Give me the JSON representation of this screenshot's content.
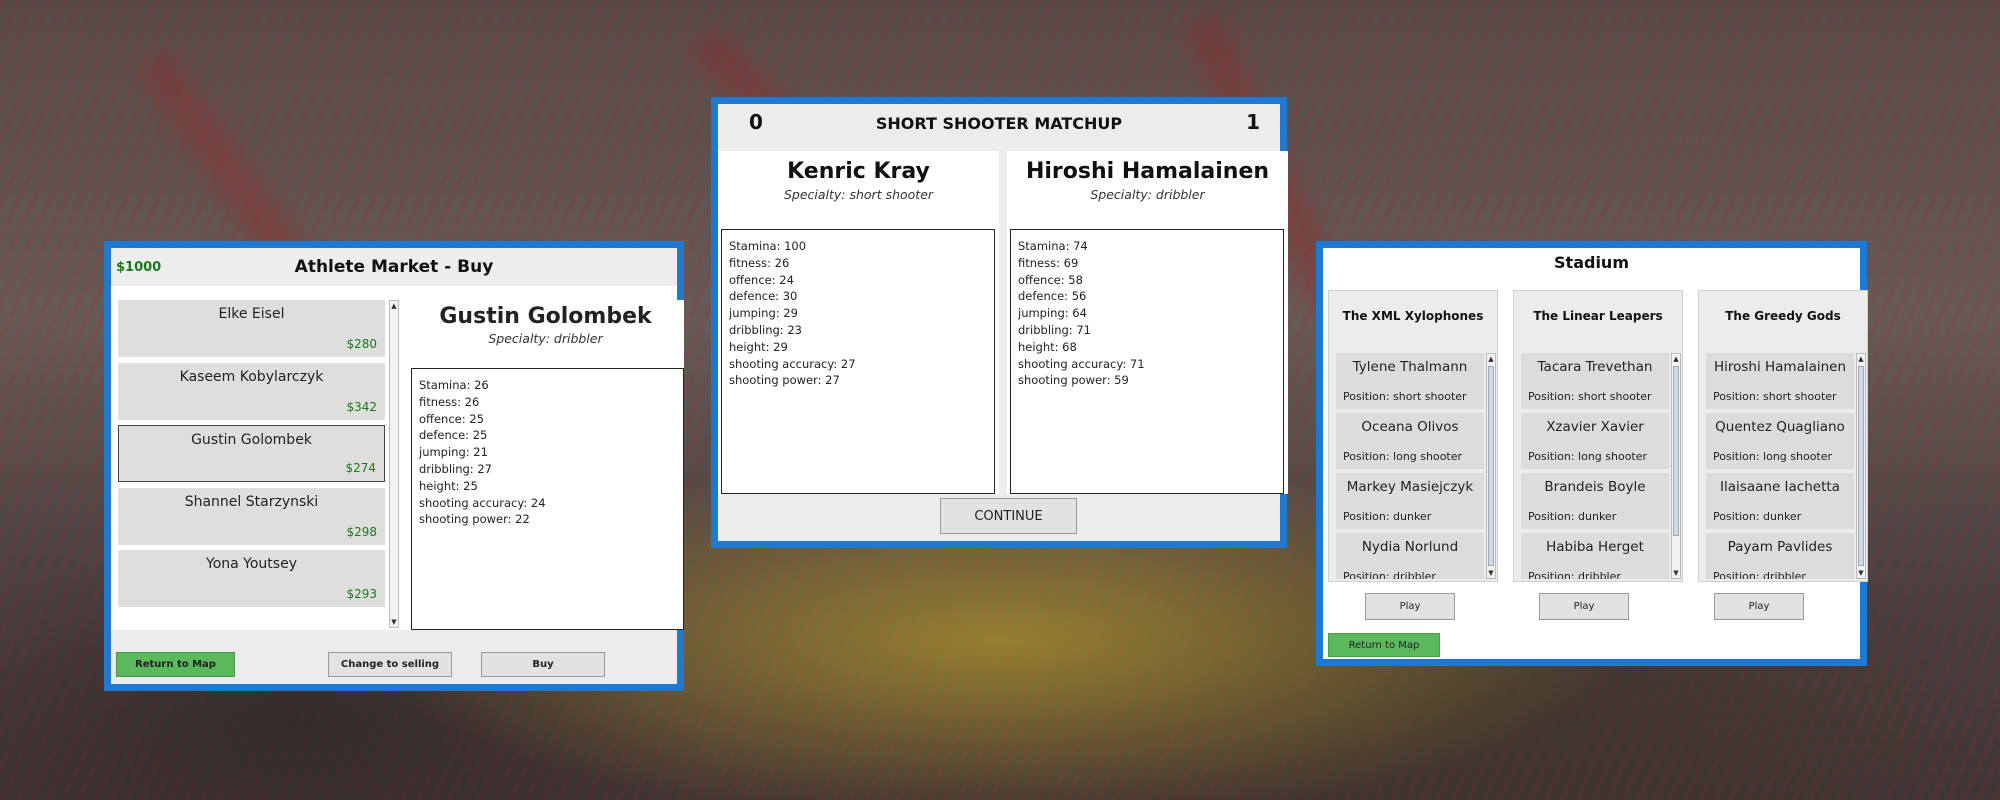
{
  "market": {
    "money": "$1000",
    "title": "Athlete Market - Buy",
    "athletes": [
      {
        "name": "Elke Eisel",
        "price": "$280"
      },
      {
        "name": "Kaseem Kobylarczyk",
        "price": "$342"
      },
      {
        "name": "Gustin Golombek",
        "price": "$274"
      },
      {
        "name": "Shannel Starzynski",
        "price": "$298"
      },
      {
        "name": "Yona Youtsey",
        "price": "$293"
      }
    ],
    "selected": {
      "name": "Gustin Golombek",
      "specialty": "Specialty: dribbler",
      "stats": [
        "Stamina: 26",
        "fitness: 26",
        "offence: 25",
        "defence: 25",
        "jumping: 21",
        "dribbling: 27",
        "height: 25",
        "shooting accuracy: 24",
        "shooting power: 22"
      ]
    },
    "buttons": {
      "return": "Return to Map",
      "change": "Change to selling",
      "buy": "Buy"
    }
  },
  "matchup": {
    "score_left": "0",
    "score_right": "1",
    "title": "SHORT SHOOTER MATCHUP",
    "left": {
      "name": "Kenric Kray",
      "specialty": "Specialty: short shooter",
      "stats": [
        "Stamina: 100",
        "fitness: 26",
        "offence: 24",
        "defence: 30",
        "jumping: 29",
        "dribbling: 23",
        "height: 29",
        "shooting accuracy: 27",
        "shooting power: 27"
      ]
    },
    "right": {
      "name": "Hiroshi Hamalainen",
      "specialty": "Specialty: dribbler",
      "stats": [
        "Stamina: 74",
        "fitness: 69",
        "offence: 58",
        "defence: 56",
        "jumping: 64",
        "dribbling: 71",
        "height: 68",
        "shooting accuracy: 71",
        "shooting power: 59"
      ]
    },
    "continue_label": "CONTINUE"
  },
  "stadium": {
    "title": "Stadium",
    "teams": [
      {
        "name": "The XML Xylophones",
        "players": [
          {
            "name": "Tylene Thalmann",
            "position": "Position: short shooter"
          },
          {
            "name": "Oceana Olivos",
            "position": "Position: long shooter"
          },
          {
            "name": "Markey Masiejczyk",
            "position": "Position: dunker"
          },
          {
            "name": "Nydia Norlund",
            "position": "Position: dribbler"
          }
        ],
        "play": "Play"
      },
      {
        "name": "The Linear Leapers",
        "players": [
          {
            "name": "Tacara Trevethan",
            "position": "Position: short shooter"
          },
          {
            "name": "Xzavier Xavier",
            "position": "Position: long shooter"
          },
          {
            "name": "Brandeis Boyle",
            "position": "Position: dunker"
          },
          {
            "name": "Habiba Herget",
            "position": "Position: dribbler"
          }
        ],
        "play": "Play"
      },
      {
        "name": "The Greedy Gods",
        "players": [
          {
            "name": "Hiroshi Hamalainen",
            "position": "Position: short shooter"
          },
          {
            "name": "Quentez Quagliano",
            "position": "Position: long shooter"
          },
          {
            "name": "Ilaisaane Iachetta",
            "position": "Position: dunker"
          },
          {
            "name": "Payam Pavlides",
            "position": "Position: dribbler"
          }
        ],
        "play": "Play"
      }
    ],
    "return": "Return to Map"
  }
}
